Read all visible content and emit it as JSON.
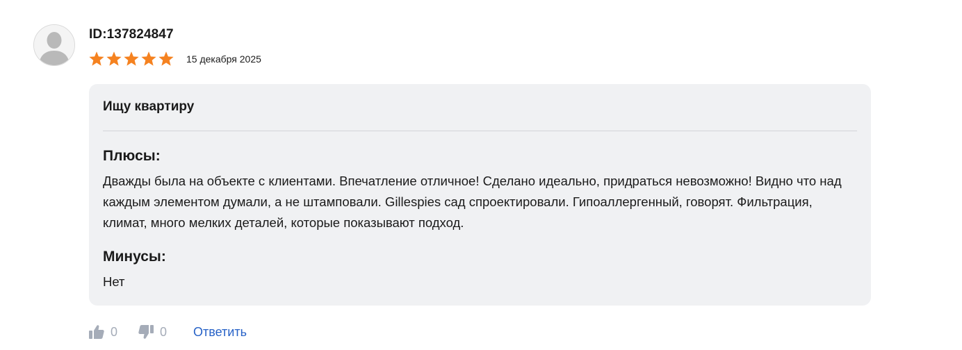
{
  "review": {
    "author": {
      "id_label": "ID:137824847",
      "avatar_icon": "user-silhouette-icon"
    },
    "rating": {
      "stars": 5,
      "max": 5,
      "star_color": "#f58220",
      "star_icon": "star-icon"
    },
    "date": "15 декабря 2025",
    "card": {
      "title": "Ищу квартиру",
      "pros_heading": "Плюсы:",
      "pros_text": "Дважды была на объекте с клиентами. Впечатление отличное! Сделано идеально, придраться невозможно! Видно что над каждым элементом думали, а не штамповали. Gillespies сад спроектировали. Гипоаллергенный, говорят. Фильтрация, климат, много мелких деталей, которые показывают подход.",
      "cons_heading": "Минусы:",
      "cons_text": "Нет",
      "background": "#f0f1f3"
    },
    "actions": {
      "like_icon": "thumbs-up-icon",
      "like_count": "0",
      "dislike_icon": "thumbs-down-icon",
      "dislike_count": "0",
      "reply_label": "Ответить",
      "reply_color": "#2762c7"
    }
  }
}
